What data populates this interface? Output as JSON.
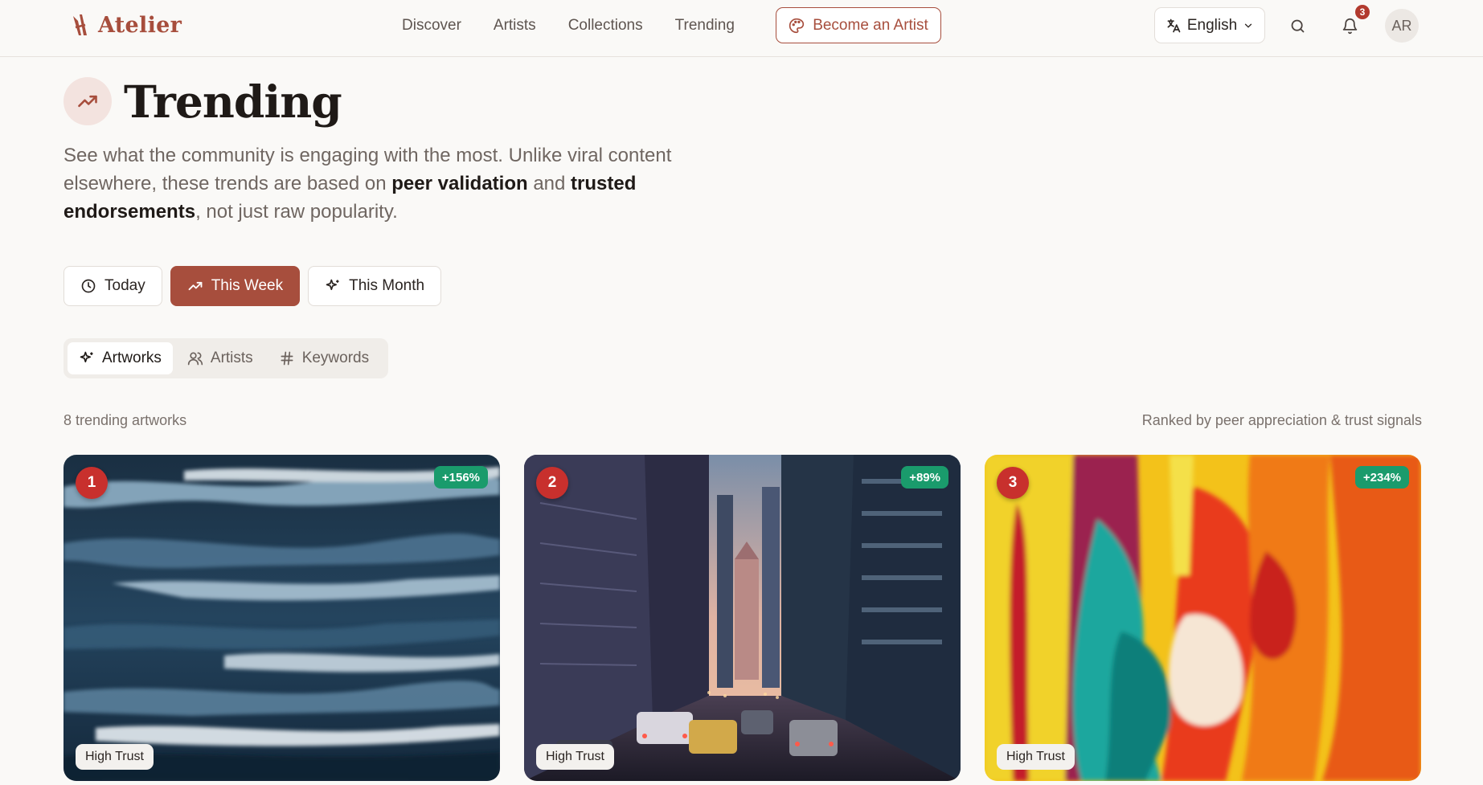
{
  "brand": {
    "name": "Atelier",
    "color": "#a74e3d"
  },
  "nav": [
    {
      "label": "Discover"
    },
    {
      "label": "Artists"
    },
    {
      "label": "Collections"
    },
    {
      "label": "Trending"
    }
  ],
  "header": {
    "become_artist_label": "Become an Artist",
    "language_label": "English",
    "notification_count": "3",
    "avatar_initials": "AR",
    "icons": [
      "palette-icon",
      "translate-icon",
      "chevron-down-icon",
      "search-icon",
      "bell-icon"
    ]
  },
  "hero": {
    "title": "Trending",
    "intro_part1": "See what the community is engaging with the most. Unlike viral content elsewhere, these trends are based on ",
    "intro_bold1": "peer validation",
    "intro_part2": " and ",
    "intro_bold2": "trusted endorsements",
    "intro_part3": ", not just raw popularity."
  },
  "period_filter": {
    "options": [
      {
        "label": "Today",
        "icon": "clock-icon"
      },
      {
        "label": "This Week",
        "icon": "trending-up-icon",
        "selected": true
      },
      {
        "label": "This Month",
        "icon": "sparkles-icon"
      }
    ]
  },
  "tabs": [
    {
      "label": "Artworks",
      "icon": "sparkles-icon",
      "selected": true
    },
    {
      "label": "Artists",
      "icon": "users-icon"
    },
    {
      "label": "Keywords",
      "icon": "hash-icon"
    }
  ],
  "list": {
    "count_text": "8 trending artworks",
    "rank_note": "Ranked by peer appreciation & trust signals"
  },
  "artworks": [
    {
      "rank": "1",
      "growth": "+156%",
      "trust": "High Trust"
    },
    {
      "rank": "2",
      "growth": "+89%",
      "trust": "High Trust"
    },
    {
      "rank": "3",
      "growth": "+234%",
      "trust": "High Trust"
    }
  ],
  "colors": {
    "accent": "#a74e3d",
    "rank_badge": "#c8302d",
    "growth_badge": "#1a9b6c",
    "background": "#faf9f7"
  }
}
